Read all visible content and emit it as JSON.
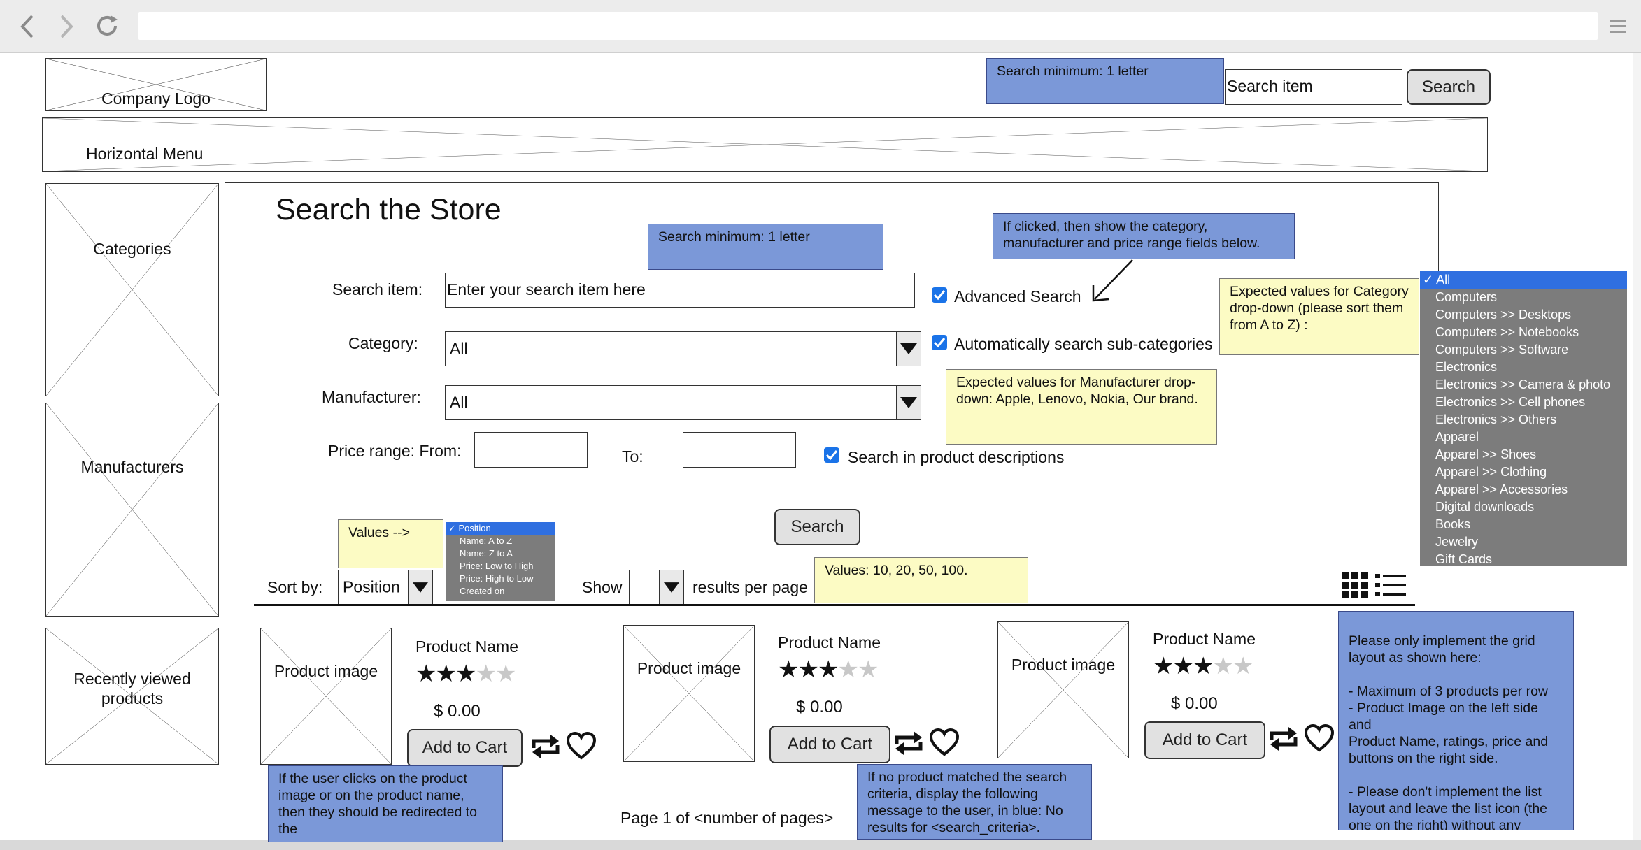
{
  "browser": {
    "back_icon": "back-arrow-icon",
    "forward_icon": "forward-arrow-icon",
    "reload_icon": "reload-icon",
    "menu_icon": "hamburger-menu-icon"
  },
  "header": {
    "logo_label": "Company Logo",
    "search_note": "Search minimum: 1 letter",
    "search_placeholder": "Search item",
    "search_button": "Search",
    "menu_label": "Horizontal Menu"
  },
  "sidebar": {
    "categories": "Categories",
    "manufacturers": "Manufacturers",
    "recently_viewed": "Recently viewed products"
  },
  "form": {
    "title": "Search the Store",
    "search_note": "Search minimum: 1 letter",
    "advanced_note": "If clicked, then show the category, manufacturer and price range fields below.",
    "search_item_label": "Search item:",
    "search_item_placeholder": "Enter your search item here",
    "advanced_search_label": "Advanced Search",
    "advanced_search_checked": true,
    "category_label": "Category:",
    "category_value": "All",
    "auto_sub_label": "Automatically search sub-categories",
    "auto_sub_checked": true,
    "manufacturer_label": "Manufacturer:",
    "manufacturer_value": "All",
    "manufacturer_note": "Expected values for Manufacturer drop-down: Apple, Lenovo, Nokia, Our brand.",
    "category_note": "Expected values for Category drop-down (please sort them from A to Z) :",
    "price_from_label": "Price range: From:",
    "price_to_label": "To:",
    "search_desc_label": "Search in product descriptions",
    "search_desc_checked": true,
    "search_button": "Search"
  },
  "category_dropdown": [
    "All",
    "Computers",
    "Computers >> Desktops",
    "Computers >> Notebooks",
    "Computers >> Software",
    "Electronics",
    "Electronics >> Camera & photo",
    "Electronics >> Cell phones",
    "Electronics >> Others",
    "Apparel",
    "Apparel >> Shoes",
    "Apparel >> Clothing",
    "Apparel >> Accessories",
    "Digital downloads",
    "Books",
    "Jewelry",
    "Gift Cards"
  ],
  "toolbar": {
    "values_note": "Values -->",
    "sort_label": "Sort by:",
    "sort_value": "Position",
    "sort_options": [
      "Position",
      "Name: A to Z",
      "Name: Z to A",
      "Price: Low to High",
      "Price: High to Low",
      "Created on"
    ],
    "show_label": "Show",
    "per_page_label": "results per page",
    "per_page_note": "Values: 10, 20, 50, 100.",
    "grid_icon": "grid-view-icon",
    "list_icon": "list-view-icon"
  },
  "products": [
    {
      "image": "Product image",
      "name": "Product Name",
      "rating": 3,
      "max_rating": 5,
      "price": "$ 0.00",
      "cart": "Add to Cart"
    },
    {
      "image": "Product image",
      "name": "Product Name",
      "rating": 3,
      "max_rating": 5,
      "price": "$ 0.00",
      "cart": "Add to Cart"
    },
    {
      "image": "Product image",
      "name": "Product Name",
      "rating": 3,
      "max_rating": 5,
      "price": "$ 0.00",
      "cart": "Add to Cart"
    }
  ],
  "notes": {
    "product_click": "If the user clicks on the product image or on the product name, then they should be redirected to the",
    "no_results": "If no product matched the search criteria, display the following message to the user, in blue: No results for <search_criteria>.",
    "grid_layout": "Please only implement the grid layout as shown here:\n\n- Maximum of 3 products per row\n- Product Image on the left side and\nProduct Name, ratings, price and buttons on the right side.\n\n- Please don't implement the list layout and leave the list icon (the one on the right) without any function when the user clicks on it."
  },
  "pagination": "Page 1 of <number of pages>"
}
